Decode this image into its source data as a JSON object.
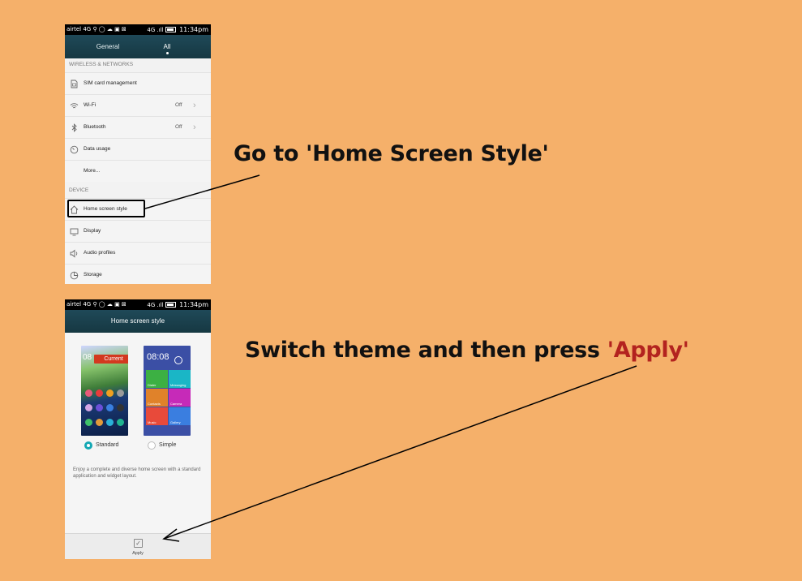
{
  "status_bar": {
    "carrier": "airtel",
    "left_icons": "4G ⚲ ◯ ☁ ▣ ⊠",
    "signal": "4G .ıll",
    "time": "11:34pm"
  },
  "settings_screen": {
    "tabs": [
      {
        "label": "General",
        "active": false
      },
      {
        "label": "All",
        "active": true
      }
    ],
    "sections": [
      {
        "header": "WIRELESS & NETWORKS",
        "items": [
          {
            "label": "SIM card management",
            "icon": "sim-card-icon",
            "value": ""
          },
          {
            "label": "Wi-Fi",
            "icon": "wifi-icon",
            "value": "Off"
          },
          {
            "label": "Bluetooth",
            "icon": "bluetooth-icon",
            "value": "Off"
          },
          {
            "label": "Data usage",
            "icon": "data-usage-icon",
            "value": ""
          },
          {
            "label": "More...",
            "icon": "",
            "value": ""
          }
        ]
      },
      {
        "header": "DEVICE",
        "items": [
          {
            "label": "Home screen style",
            "icon": "home-icon",
            "value": ""
          },
          {
            "label": "Display",
            "icon": "display-icon",
            "value": ""
          },
          {
            "label": "Audio profiles",
            "icon": "speaker-icon",
            "value": ""
          },
          {
            "label": "Storage",
            "icon": "storage-icon",
            "value": ""
          }
        ]
      }
    ]
  },
  "home_style_screen": {
    "title": "Home screen style",
    "current_badge": "Current",
    "standard_clock": "08",
    "simple_clock": "08:08",
    "options": [
      {
        "label": "Standard",
        "selected": true
      },
      {
        "label": "Simple",
        "selected": false
      }
    ],
    "simple_tiles": [
      "Dialer",
      "Messaging",
      "Contacts",
      "Camera",
      "Music",
      "Gallery"
    ],
    "description": "Enjoy a complete and diverse home screen with a standard application and widget layout.",
    "apply_label": "Apply"
  },
  "instructions": {
    "step1": "Go to 'Home Screen Style'",
    "step2_prefix": "Switch theme and then press ",
    "step2_highlight": "'Apply'"
  },
  "colors": {
    "background": "#f5b06a",
    "accent_red": "#b3231f",
    "header_teal": "#1f4958",
    "radio_selected": "#14a8b4"
  }
}
